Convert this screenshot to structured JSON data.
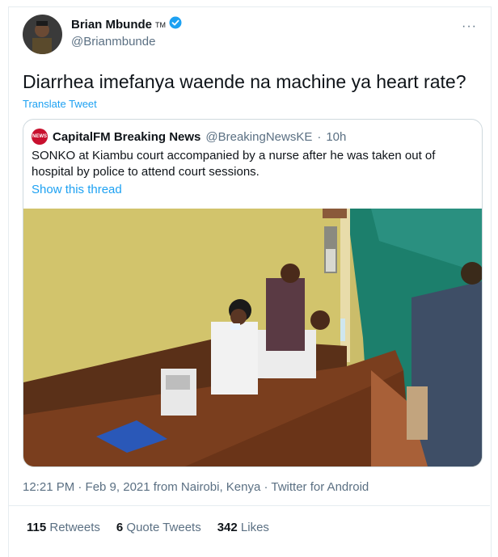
{
  "author": {
    "name": "Brian Mbunde",
    "tm": "TM",
    "handle": "@Brianmbunde"
  },
  "more_label": "···",
  "tweet": {
    "text": "Diarrhea imefanya waende na machine ya heart rate?",
    "translate_label": "Translate Tweet"
  },
  "quote": {
    "logo_text": "NEWS",
    "name": "CapitalFM Breaking News",
    "handle": "@BreakingNewsKE",
    "separator": "·",
    "time": "10h",
    "text": "SONKO at Kiambu court accompanied by a nurse after he was taken out of hospital by police to attend court sessions.",
    "show_thread": "Show this thread"
  },
  "meta": {
    "time_line": "12:21 PM · Feb 9, 2021 from Nairobi, Kenya · Twitter for Android"
  },
  "stats": {
    "retweets_count": "115",
    "retweets_label": "Retweets",
    "quotes_count": "6",
    "quotes_label": "Quote Tweets",
    "likes_count": "342",
    "likes_label": "Likes"
  },
  "colors": {
    "link": "#1da1f2",
    "verified": "#1da1f2",
    "muted": "#5b7083"
  }
}
